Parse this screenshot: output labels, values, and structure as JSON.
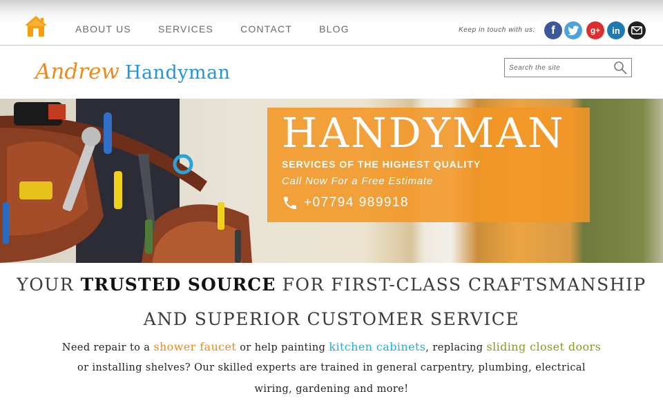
{
  "nav": {
    "home_icon": "house-icon",
    "items": [
      {
        "label": "ABOUT US"
      },
      {
        "label": "SERVICES"
      },
      {
        "label": "CONTACT"
      },
      {
        "label": "BLOG"
      }
    ]
  },
  "social": {
    "label": "Keep in touch with us:",
    "icons": [
      {
        "name": "facebook-icon",
        "glyph": "f",
        "color": "#3b5998"
      },
      {
        "name": "twitter-icon",
        "glyph": "",
        "color": "#4aa3dd"
      },
      {
        "name": "google-plus-icon",
        "glyph": "g+",
        "color": "#dc2e2e"
      },
      {
        "name": "linkedin-icon",
        "glyph": "in",
        "color": "#1f7ab4"
      },
      {
        "name": "email-icon",
        "glyph": "",
        "color": "#222222"
      }
    ]
  },
  "logo": {
    "first": "Andrew",
    "second": "Handyman",
    "first_color": "#f08a1c",
    "second_color": "#1e96e0"
  },
  "search": {
    "placeholder": "Search the site",
    "value": ""
  },
  "hero": {
    "title": "HANDYMAN",
    "subtitle": "SERVICES OF THE HIGHEST QUALITY",
    "call": "Call Now For a Free Estimate",
    "phone": "+07794 989918",
    "box_color": "#f29624"
  },
  "intro": {
    "h_pre": "YOUR ",
    "h_bold": "TRUSTED SOURCE",
    "h_post": " FOR FIRST-CLASS CRAFTSMANSHIP",
    "h_line2": "AND SUPERIOR CUSTOMER SERVICE",
    "p1_a": "Need repair to a ",
    "link1": "shower faucet",
    "p1_b": " or help painting ",
    "link2": "kitchen cabinets",
    "p1_c": ", replacing ",
    "link3": "sliding closet doors",
    "p2": "or installing shelves? Our skilled experts are trained in general carpentry, plumbing, electrical",
    "p3": "wiring, gardening and more!"
  }
}
